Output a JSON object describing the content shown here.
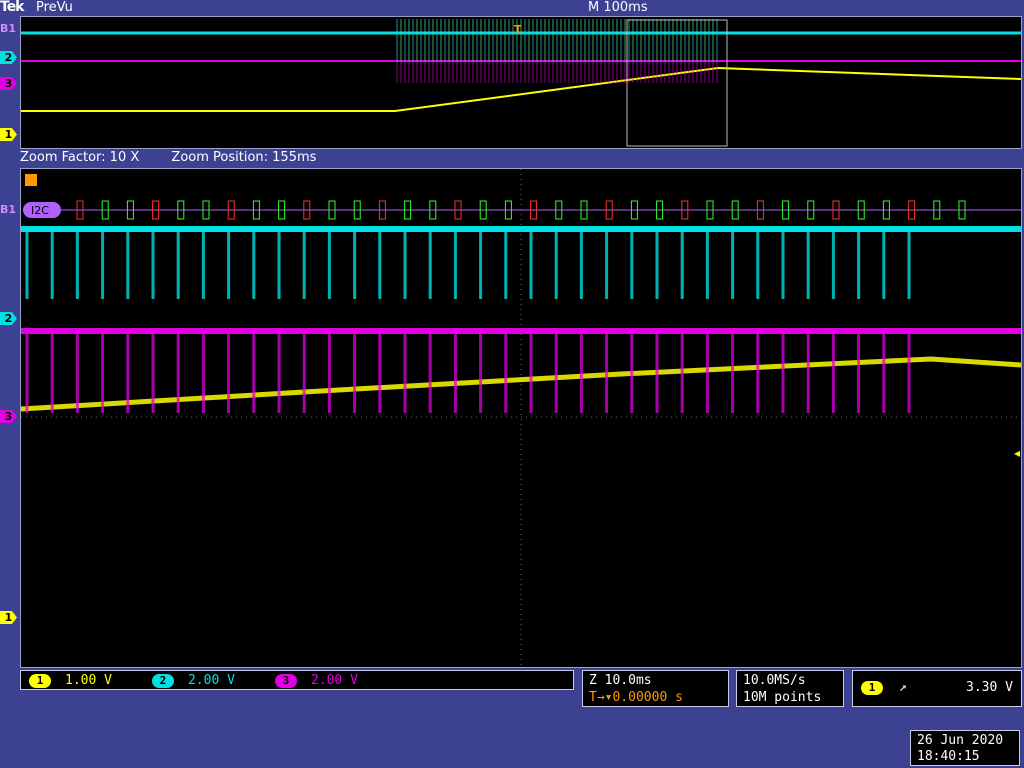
{
  "header": {
    "brand": "Tek",
    "mode": "PreVu",
    "timebase": "M 100ms"
  },
  "zoom": {
    "factor_label": "Zoom Factor: 10 X",
    "position_label": "Zoom Position: 155ms"
  },
  "channel_markers": {
    "ch1": "1",
    "ch2": "2",
    "ch3": "3",
    "bus": "B1",
    "bus_label": "I2C",
    "trigger": "T"
  },
  "colors": {
    "ch1": "#ffff00",
    "ch2": "#00e0e0",
    "ch3": "#e000e0",
    "bus": "#b060ff",
    "trigger": "#ff9900",
    "screen_bg": "#000000",
    "frame_bg": "#3c4191"
  },
  "channels": [
    {
      "id": "1",
      "scale": "1.00 V"
    },
    {
      "id": "2",
      "scale": "2.00 V"
    },
    {
      "id": "3",
      "scale": "2.00 V"
    }
  ],
  "horizontal": {
    "zoom_scale": "Z 10.0ms",
    "trigger_pos": "0.00000 s"
  },
  "acquisition": {
    "sample_rate": "10.0MS/s",
    "record_length": "10M points"
  },
  "trigger": {
    "source": "1",
    "slope_icon": "rising-edge-icon",
    "level": "3.30 V"
  },
  "datetime": {
    "date": "26 Jun 2020",
    "time": "18:40:15"
  }
}
